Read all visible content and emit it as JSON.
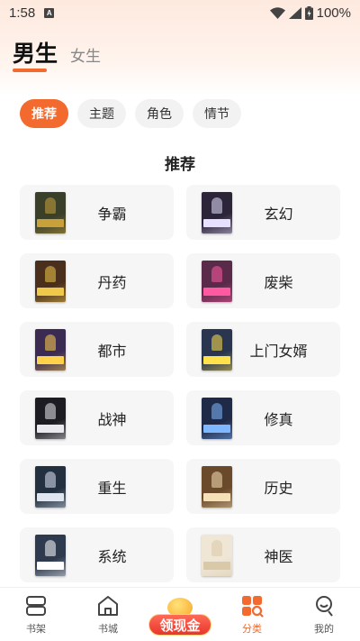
{
  "status_bar": {
    "time": "1:58",
    "notification_letter": "A",
    "battery_percent": "100%",
    "icons": [
      "wifi-icon",
      "signal-icon",
      "battery-icon"
    ]
  },
  "gender_tabs": [
    {
      "label": "男生",
      "active": true
    },
    {
      "label": "女生",
      "active": false
    }
  ],
  "filters": [
    {
      "label": "推荐",
      "active": true
    },
    {
      "label": "主题",
      "active": false
    },
    {
      "label": "角色",
      "active": false
    },
    {
      "label": "情节",
      "active": false
    }
  ],
  "section_title": "推荐",
  "categories": [
    {
      "label": "争霸"
    },
    {
      "label": "玄幻"
    },
    {
      "label": "丹药"
    },
    {
      "label": "废柴"
    },
    {
      "label": "都市"
    },
    {
      "label": "上门女婿"
    },
    {
      "label": "战神"
    },
    {
      "label": "修真"
    },
    {
      "label": "重生"
    },
    {
      "label": "历史"
    },
    {
      "label": "系统"
    },
    {
      "label": "神医"
    }
  ],
  "cover_colors": [
    [
      "#3a3f2a",
      "#c9a13b"
    ],
    [
      "#2c2438",
      "#e8e0ff"
    ],
    [
      "#4a2f1c",
      "#f0c84a"
    ],
    [
      "#5a2a4a",
      "#ff5aa0"
    ],
    [
      "#3b2a52",
      "#ffd24a"
    ],
    [
      "#2a3550",
      "#ffe14a"
    ],
    [
      "#1c1c22",
      "#e9e9ee"
    ],
    [
      "#1f2a48",
      "#7fb8ff"
    ],
    [
      "#223040",
      "#e0e6f0"
    ],
    [
      "#6a4a2a",
      "#f6e0b8"
    ],
    [
      "#2e3a4e",
      "#ffffff"
    ],
    [
      "#efe6d6",
      "#d9c9a8"
    ]
  ],
  "bottom_nav": [
    {
      "label": "书架",
      "icon": "bookshelf-icon",
      "active": false
    },
    {
      "label": "书城",
      "icon": "home-icon",
      "active": false
    },
    {
      "label": "领现金",
      "icon": "coin-icon",
      "active": false
    },
    {
      "label": "分类",
      "icon": "category-icon",
      "active": true
    },
    {
      "label": "我的",
      "icon": "profile-icon",
      "active": false
    }
  ],
  "colors": {
    "accent": "#f36a2f",
    "card_bg": "#f6f6f6",
    "chip_bg": "#f2f2f2"
  }
}
